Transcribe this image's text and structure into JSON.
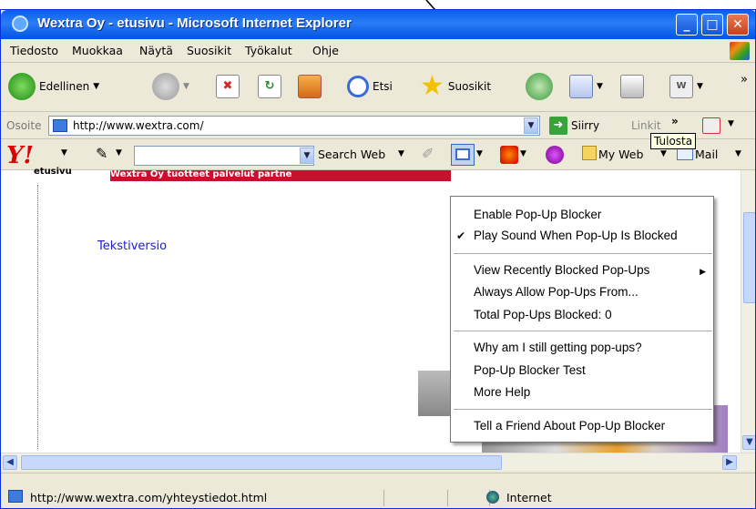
{
  "window": {
    "title": "Wextra Oy - etusivu - Microsoft Internet Explorer",
    "min": "_",
    "max": "□",
    "close": "✕"
  },
  "menubar": {
    "items": [
      "Tiedosto",
      "Muokkaa",
      "Näytä",
      "Suosikit",
      "Työkalut",
      "Ohje"
    ]
  },
  "toolbar": {
    "back": "Edellinen",
    "search": "Etsi",
    "favorites": "Suosikit",
    "more": "»"
  },
  "addressbar": {
    "label": "Osoite",
    "url": "http://www.wextra.com/",
    "go": "Siirry",
    "links": "Linkit",
    "more": "»"
  },
  "tooltip": "Tulosta",
  "yahoobar": {
    "logo": "Y!",
    "search_web": "Search Web",
    "my_web": "My Web",
    "mail": "Mail"
  },
  "page": {
    "nav_left": "etusivu",
    "nav_band": "Wextra Oy   tuotteet   palvelut   partne",
    "text_version": "Tekstiversio"
  },
  "popup_menu": {
    "items": [
      "Enable Pop-Up Blocker",
      "Play Sound When Pop-Up Is Blocked",
      "View Recently Blocked Pop-Ups",
      "Always Allow Pop-Ups From...",
      "Total Pop-Ups Blocked: 0",
      "Why am I still getting pop-ups?",
      "Pop-Up Blocker Test",
      "More Help",
      "Tell a Friend About Pop-Up Blocker"
    ],
    "checked_index": 1,
    "submenu_index": 2
  },
  "statusbar": {
    "url": "http://www.wextra.com/yhteystiedot.html",
    "zone": "Internet"
  },
  "colors": {
    "title_blue": "#0a5fe8",
    "brand_red": "#c8102e",
    "link_blue": "#1b1bd6",
    "chrome": "#ece9d8"
  }
}
